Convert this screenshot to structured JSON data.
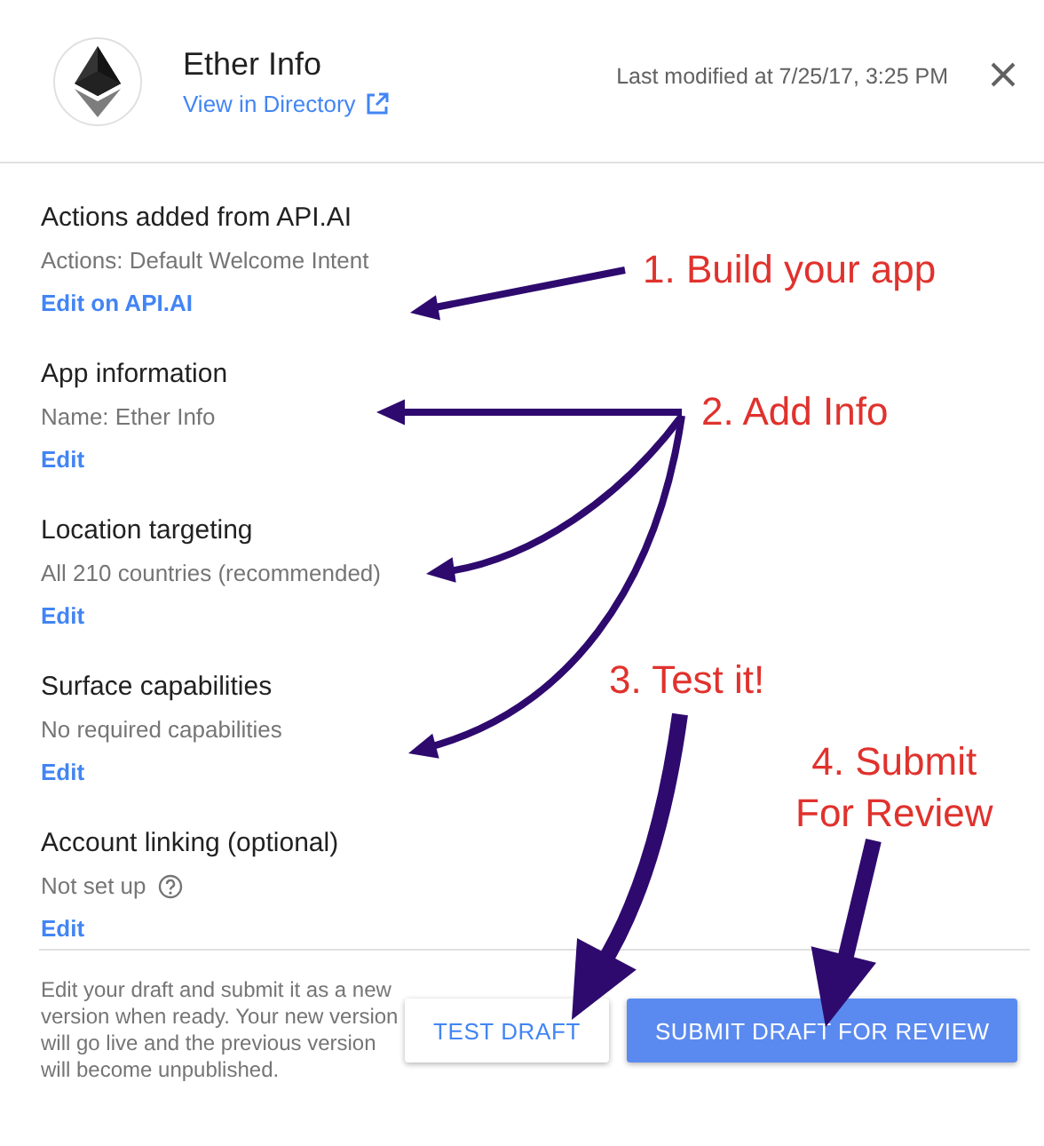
{
  "header": {
    "title": "Ether Info",
    "link": "View in Directory",
    "modified": "Last modified at 7/25/17, 3:25 PM"
  },
  "sections": [
    {
      "title": "Actions added from API.AI",
      "detail": "Actions: Default Welcome Intent",
      "action": "Edit on API.AI",
      "help": false
    },
    {
      "title": "App information",
      "detail": "Name: Ether Info",
      "action": "Edit",
      "help": false
    },
    {
      "title": "Location targeting",
      "detail": "All 210 countries (recommended)",
      "action": "Edit",
      "help": false
    },
    {
      "title": "Surface capabilities",
      "detail": "No required capabilities",
      "action": "Edit",
      "help": false
    },
    {
      "title": "Account linking (optional)",
      "detail": "Not set up",
      "action": "Edit",
      "help": true
    }
  ],
  "footer": {
    "note": "Edit your draft and submit it as a new version when ready. Your new version will go live and the previous version will become unpublished.",
    "buttons": [
      {
        "label": "TEST DRAFT",
        "kind": "outlined"
      },
      {
        "label": "SUBMIT DRAFT FOR REVIEW",
        "kind": "primary"
      }
    ]
  },
  "annotations": [
    {
      "text": "1. Build your app"
    },
    {
      "text": "2. Add Info"
    },
    {
      "text": "3. Test it!"
    },
    {
      "text": "4. Submit\nFor Review"
    }
  ]
}
